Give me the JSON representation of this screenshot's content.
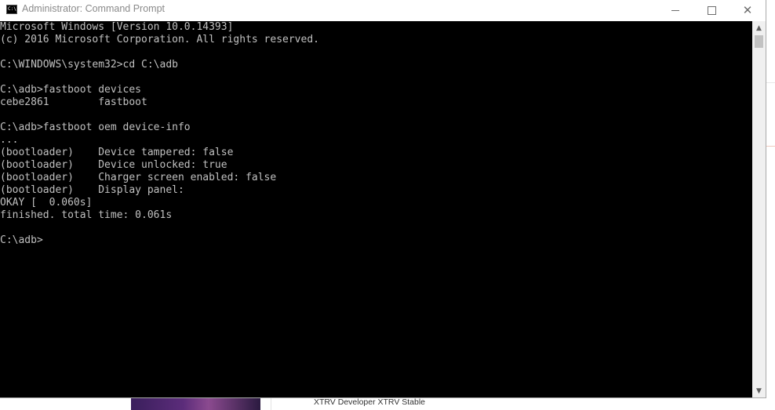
{
  "window": {
    "title": "Administrator: Command Prompt",
    "icon": "cmd-icon"
  },
  "console": {
    "lines": [
      "Microsoft Windows [Version 10.0.14393]",
      "(c) 2016 Microsoft Corporation. All rights reserved.",
      "",
      "C:\\WINDOWS\\system32>cd C:\\adb",
      "",
      "C:\\adb>fastboot devices",
      "cebe2861        fastboot",
      "",
      "C:\\adb>fastboot oem device-info",
      "...",
      "(bootloader)    Device tampered: false",
      "(bootloader)    Device unlocked: true",
      "(bootloader)    Charger screen enabled: false",
      "(bootloader)    Display panel:",
      "OKAY [  0.060s]",
      "finished. total time: 0.061s",
      "",
      "C:\\adb>"
    ]
  },
  "background": {
    "caption": "XTRV Developer XTRV Stable"
  },
  "colors": {
    "console_bg": "#000000",
    "console_text": "#c0c0c0",
    "titlebar_bg": "#ffffff"
  }
}
